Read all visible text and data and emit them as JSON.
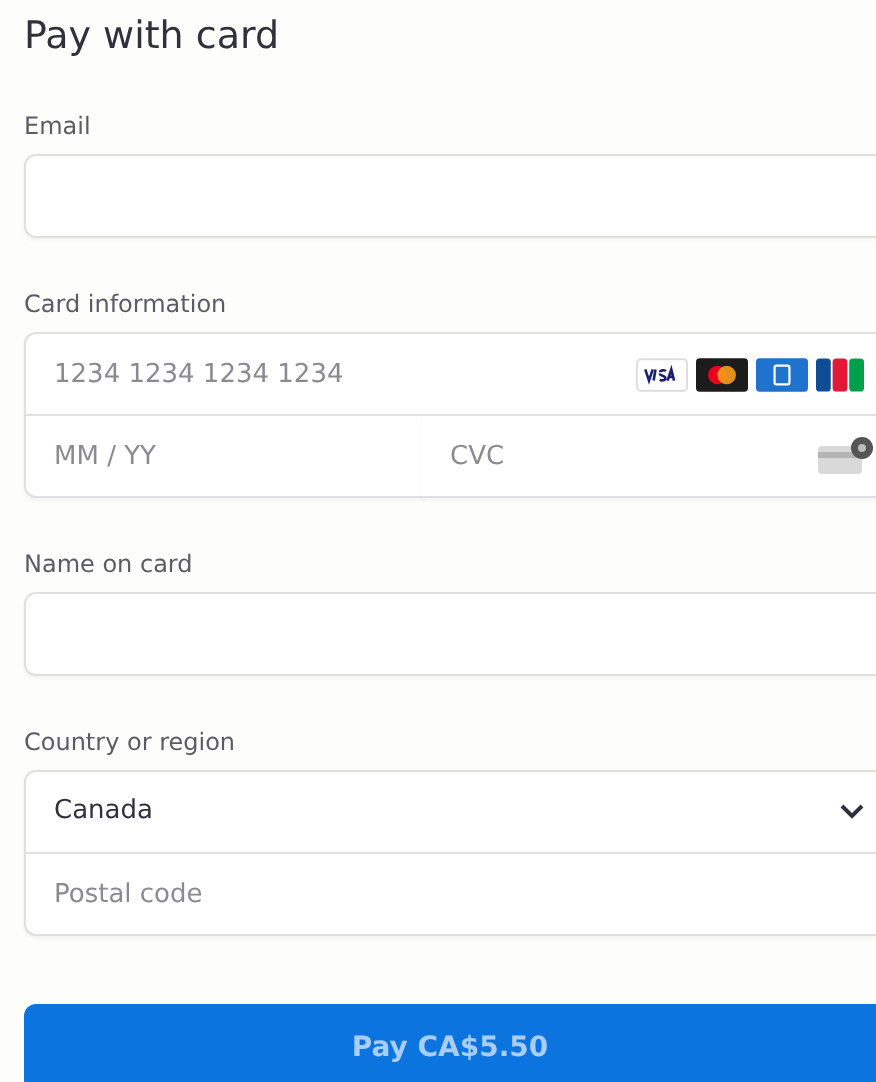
{
  "title": "Pay with card",
  "email": {
    "label": "Email"
  },
  "card": {
    "label": "Card information",
    "number_placeholder": "1234 1234 1234 1234",
    "expiry_placeholder": "MM / YY",
    "cvc_placeholder": "CVC"
  },
  "name": {
    "label": "Name on card"
  },
  "country": {
    "label": "Country or region",
    "value": "Canada",
    "postal_placeholder": "Postal code"
  },
  "pay_button": {
    "label": "Pay CA$5.50",
    "disabled": true
  }
}
